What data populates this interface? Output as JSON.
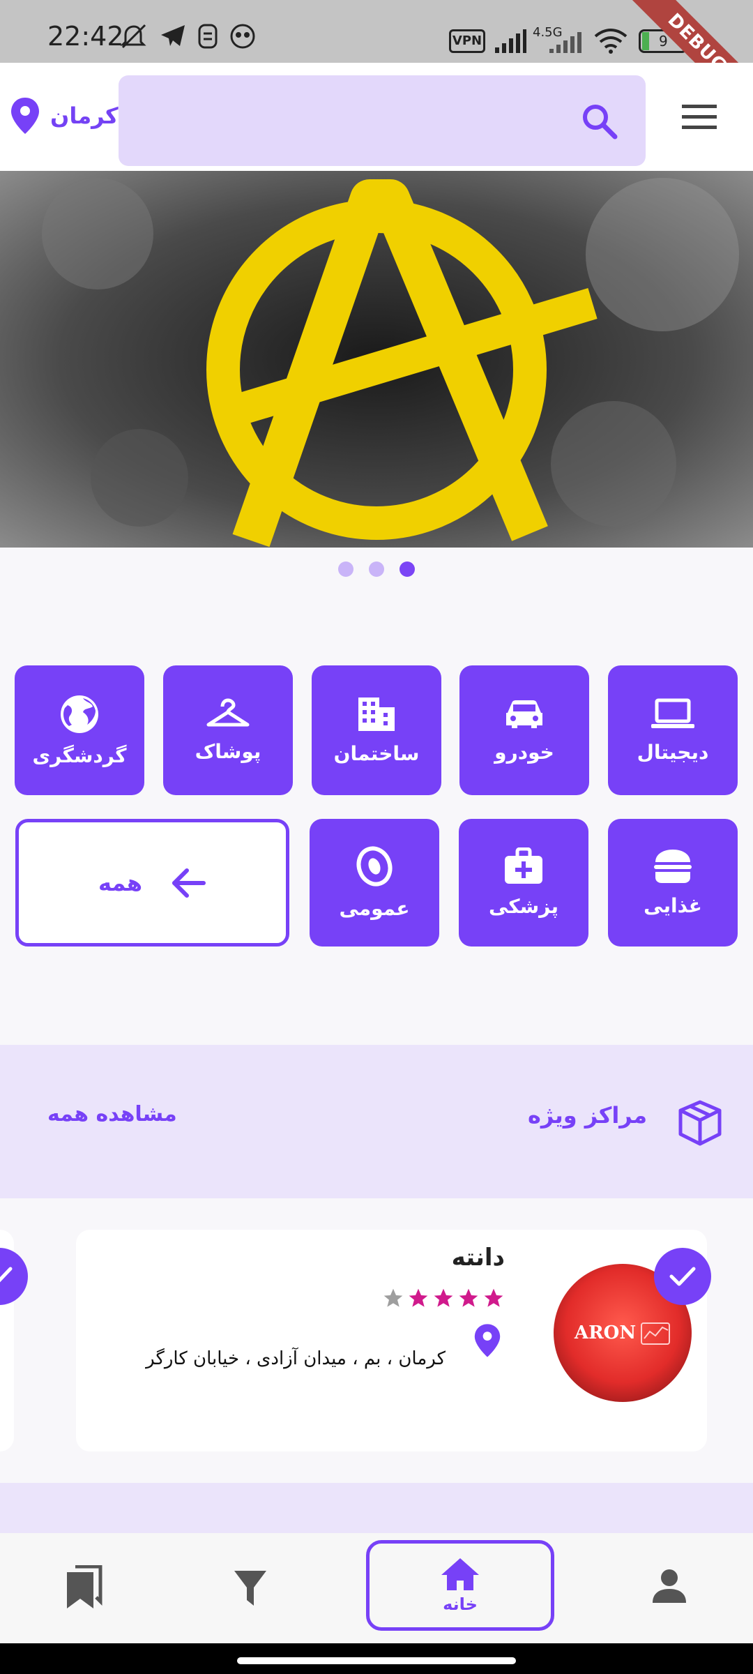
{
  "status_bar": {
    "time": "22:42",
    "icons": [
      "mute-icon",
      "telegram-icon",
      "sim-icon",
      "app-icon",
      "vpn-icon",
      "signal-icon",
      "signal-4g-icon",
      "wifi-icon",
      "battery-icon"
    ],
    "vpn_label": "VPN",
    "network_label": "4.5G",
    "battery_level": "9",
    "debug_label": "DEBUG"
  },
  "header": {
    "location": "کرمان",
    "icons": [
      "location-pin-icon",
      "search-icon",
      "menu-icon"
    ]
  },
  "banner": {
    "slide_count": 3,
    "active_slide": 3
  },
  "categories": [
    {
      "label": "دیجیتال",
      "icon": "laptop-icon"
    },
    {
      "label": "خودرو",
      "icon": "car-icon"
    },
    {
      "label": "ساختمان",
      "icon": "building-icon"
    },
    {
      "label": "پوشاک",
      "icon": "hanger-icon"
    },
    {
      "label": "گردشگری",
      "icon": "globe-icon"
    },
    {
      "label": "غذایی",
      "icon": "burger-icon"
    },
    {
      "label": "پزشکی",
      "icon": "medical-kit-icon"
    },
    {
      "label": "عمومی",
      "icon": "general-logo-icon"
    }
  ],
  "all_categories": {
    "label": "همه",
    "icon": "arrow-left-icon"
  },
  "featured": {
    "title": "مراکز ویژه",
    "see_all": "مشاهده همه",
    "icon": "box-icon"
  },
  "card": {
    "title": "دانته",
    "rating": 4,
    "rating_max": 5,
    "address": "کرمان ، بم ، میدان آزادی ، خیابان کارگر",
    "logo_text": "ARON",
    "colors": {
      "star_filled": "#d01a8c",
      "star_empty": "#9e9e9e"
    }
  },
  "bottom_nav": {
    "items": [
      {
        "name": "bookmark",
        "icon": "bookmarks-icon"
      },
      {
        "name": "filter",
        "icon": "filter-icon"
      },
      {
        "name": "home",
        "icon": "home-icon",
        "label": "خانه",
        "active": true
      },
      {
        "name": "profile",
        "icon": "person-icon"
      }
    ]
  },
  "colors": {
    "accent": "#7741f7",
    "accent_light": "#e3d8fb"
  }
}
